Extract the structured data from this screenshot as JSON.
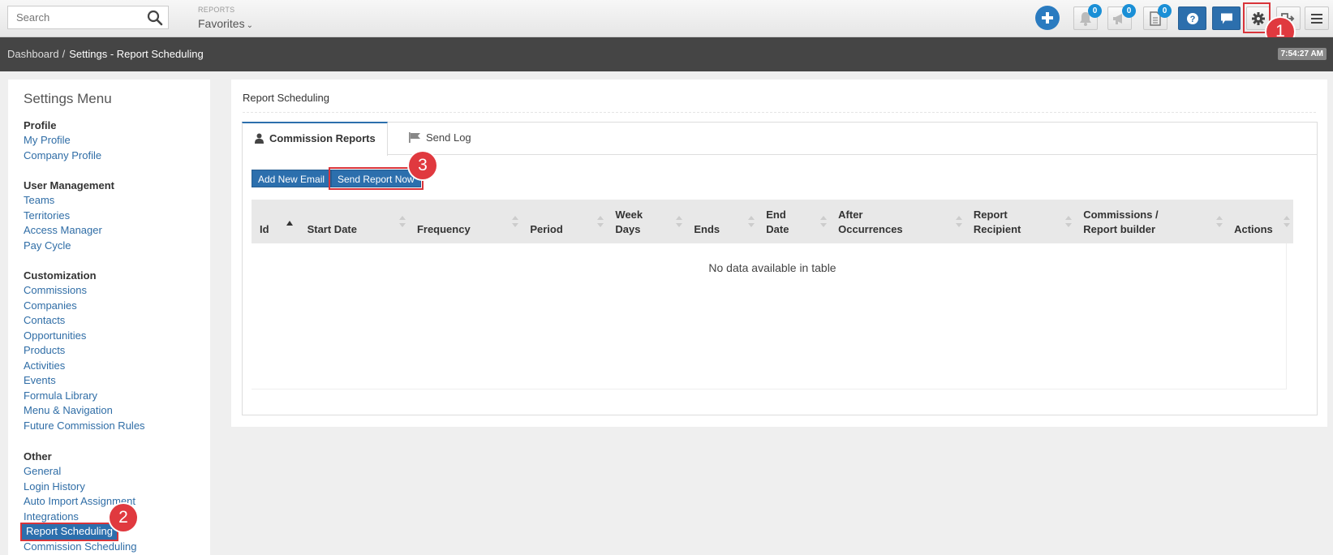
{
  "topbar": {
    "search": {
      "placeholder": "Search",
      "value": ""
    },
    "reports_label": "REPORTS",
    "favorites_label": "Favorites",
    "notifications_count": "0",
    "announcements_count": "0",
    "documents_count": "0"
  },
  "breadcrumb": {
    "items": [
      "Dashboard",
      "Settings - Report Scheduling"
    ],
    "separator": "/",
    "clock": "7:54:27 AM"
  },
  "sidebar": {
    "title": "Settings Menu",
    "groups": [
      {
        "title": "Profile",
        "items": [
          "My Profile",
          "Company Profile"
        ]
      },
      {
        "title": "User Management",
        "items": [
          "Teams",
          "Territories",
          "Access Manager",
          "Pay Cycle"
        ]
      },
      {
        "title": "Customization",
        "items": [
          "Commissions",
          "Companies",
          "Contacts",
          "Opportunities",
          "Products",
          "Activities",
          "Events",
          "Formula Library",
          "Menu & Navigation",
          "Future Commission Rules"
        ]
      },
      {
        "title": "Other",
        "items": [
          "General",
          "Login History",
          "Auto Import Assignment",
          "Integrations",
          "Report Scheduling",
          "Commission Scheduling"
        ]
      }
    ],
    "active_item": "Report Scheduling"
  },
  "main": {
    "title": "Report Scheduling",
    "tabs": [
      {
        "label": "Commission Reports",
        "icon": "user-icon",
        "active": true
      },
      {
        "label": "Send Log",
        "icon": "flag-icon",
        "active": false
      }
    ],
    "buttons": {
      "add_email": "Add New Email",
      "send_now": "Send Report Now"
    },
    "table": {
      "columns": [
        {
          "line1": "",
          "line2": "Id"
        },
        {
          "line1": "",
          "line2": "Start Date"
        },
        {
          "line1": "",
          "line2": "Frequency"
        },
        {
          "line1": "",
          "line2": "Period"
        },
        {
          "line1": "Week",
          "line2": "Days"
        },
        {
          "line1": "",
          "line2": "Ends"
        },
        {
          "line1": "End",
          "line2": "Date"
        },
        {
          "line1": "After",
          "line2": "Occurrences"
        },
        {
          "line1": "Report",
          "line2": "Recipient"
        },
        {
          "line1": "Commissions /",
          "line2": "Report builder"
        },
        {
          "line1": "",
          "line2": "Actions"
        }
      ],
      "empty_message": "No data available in table"
    }
  },
  "annotations": {
    "callout_1": "1",
    "callout_2": "2",
    "callout_3": "3"
  },
  "colors": {
    "accent": "#2c6fad",
    "highlight": "#d9343a",
    "crumbbar": "#454545"
  }
}
